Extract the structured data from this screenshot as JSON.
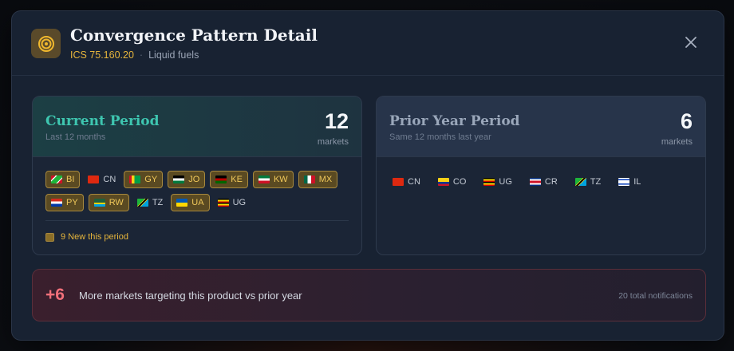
{
  "dialog": {
    "title": "Convergence Pattern Detail",
    "code": "ICS 75.160.20",
    "separator": "·",
    "category": "Liquid fuels",
    "header_icon": "target-icon",
    "close_icon": "close-icon"
  },
  "current": {
    "title": "Current Period",
    "subtitle": "Last 12 months",
    "count": "12",
    "count_label": "markets",
    "markets": [
      {
        "code": "BI",
        "new": true
      },
      {
        "code": "CN",
        "new": false
      },
      {
        "code": "GY",
        "new": true
      },
      {
        "code": "JO",
        "new": true
      },
      {
        "code": "KE",
        "new": true
      },
      {
        "code": "KW",
        "new": true
      },
      {
        "code": "MX",
        "new": true
      },
      {
        "code": "PY",
        "new": true
      },
      {
        "code": "RW",
        "new": true
      },
      {
        "code": "TZ",
        "new": false
      },
      {
        "code": "UA",
        "new": true
      },
      {
        "code": "UG",
        "new": false
      }
    ],
    "new_label": "9 New this period"
  },
  "prior": {
    "title": "Prior Year Period",
    "subtitle": "Same 12 months last year",
    "count": "6",
    "count_label": "markets",
    "markets": [
      {
        "code": "CN"
      },
      {
        "code": "CO"
      },
      {
        "code": "UG"
      },
      {
        "code": "CR"
      },
      {
        "code": "TZ"
      },
      {
        "code": "IL"
      }
    ]
  },
  "banner": {
    "delta": "+6",
    "message": "More markets targeting this product vs prior year",
    "note": "20 total notifications"
  },
  "colors": {
    "accent_gold": "#e6b53c",
    "accent_teal": "#3ec6b0",
    "delta_red": "#f2707a"
  }
}
